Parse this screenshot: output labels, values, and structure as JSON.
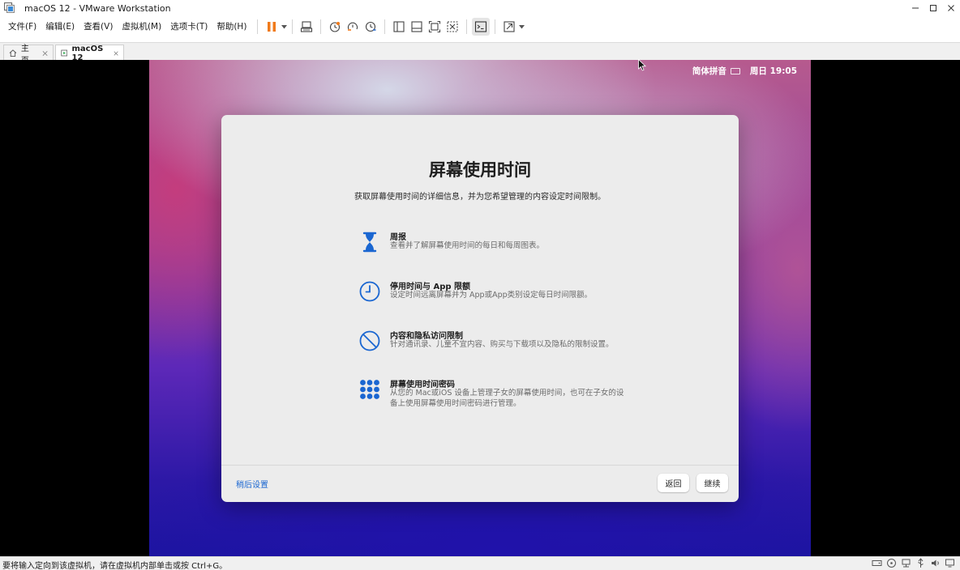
{
  "window": {
    "title": "macOS 12 - VMware Workstation",
    "icon": "vmware-app-icon"
  },
  "menu": {
    "items": [
      "文件(F)",
      "编辑(E)",
      "查看(V)",
      "虚拟机(M)",
      "选项卡(T)",
      "帮助(H)"
    ]
  },
  "toolbar": {
    "icons": [
      "pause-icon",
      "send-ctrl-alt-del-icon",
      "snapshot-icon",
      "revert-snapshot-icon",
      "snapshot-manager-icon",
      "library-icon",
      "thumbnail-bar-icon",
      "fit-guest-icon",
      "autofit-icon",
      "console-view-icon",
      "fullscreen-icon"
    ],
    "pause_color": "#f07a1a"
  },
  "tabs": [
    {
      "label": "主页",
      "icon": "home-icon"
    },
    {
      "label": "macOS 12",
      "icon": "vm-icon"
    }
  ],
  "vm": {
    "input_method": "简体拼音",
    "clock": "周日 19:05"
  },
  "dialog": {
    "title": "屏幕使用时间",
    "subtitle": "获取屏幕使用时间的详细信息，并为您希望管理的内容设定时间限制。",
    "features": [
      {
        "icon": "hourglass-icon",
        "title": "周报",
        "desc": "查看并了解屏幕使用时间的每日和每周图表。"
      },
      {
        "icon": "clock-icon",
        "title": "停用时间与 App 限额",
        "desc": "设定时间远离屏幕并为 App或App类别设定每日时间限额。"
      },
      {
        "icon": "restriction-icon",
        "title": "内容和隐私访问限制",
        "desc": "针对通讯录、儿童不宜内容、购买与下载项以及隐私的限制设置。"
      },
      {
        "icon": "passcode-icon",
        "title": "屏幕使用时间密码",
        "desc": "从您的 Mac或iOS 设备上管理子女的屏幕使用时间，也可在子女的设备上使用屏幕使用时间密码进行管理。"
      }
    ],
    "later_label": "稍后设置",
    "back_label": "返回",
    "continue_label": "继续",
    "accent_color": "#1a66d1"
  },
  "statusbar": {
    "text": "要将输入定向到该虚拟机，请在虚拟机内部单击或按 Ctrl+G。"
  }
}
